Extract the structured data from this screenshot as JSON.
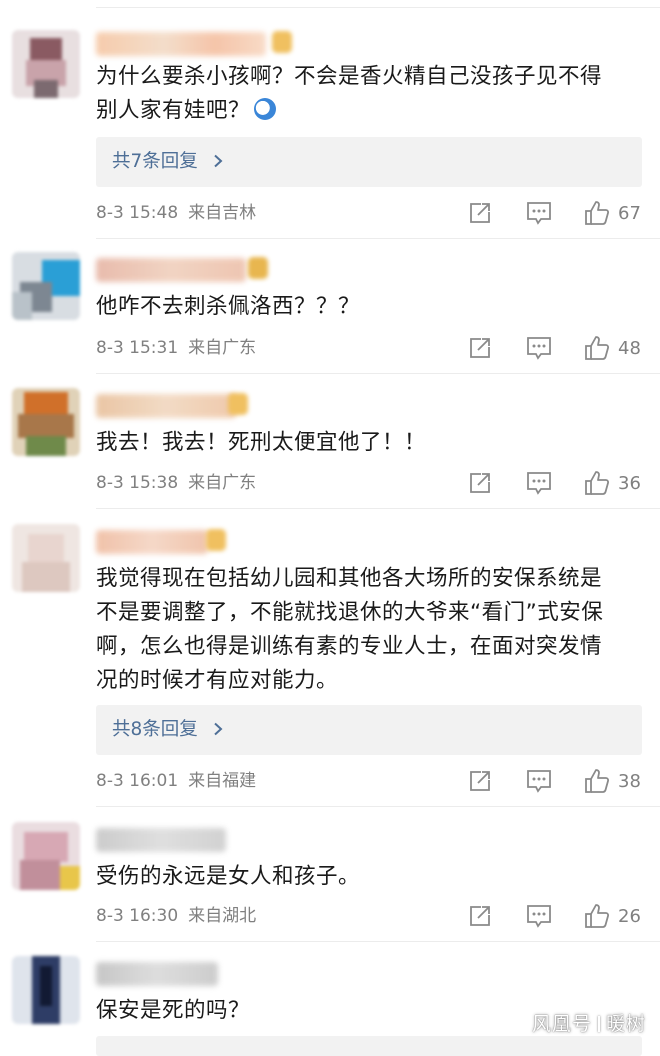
{
  "comments": [
    {
      "text_lines": [
        "为什么要杀小孩啊？不会是香火精自己没孩子见不得",
        "别人家有娃吧？"
      ],
      "has_emoji": true,
      "replies": "共7条回复",
      "time": "8-3 15:48",
      "location": "来自吉林",
      "likes": "67"
    },
    {
      "text_lines": [
        "他咋不去刺杀佩洛西？？？"
      ],
      "time": "8-3 15:31",
      "location": "来自广东",
      "likes": "48"
    },
    {
      "text_lines": [
        "我去！我去！死刑太便宜他了！！"
      ],
      "time": "8-3 15:38",
      "location": "来自广东",
      "likes": "36"
    },
    {
      "text_lines": [
        "我觉得现在包括幼儿园和其他各大场所的安保系统是",
        "不是要调整了，不能就找退休的大爷来“看门”式安保",
        "啊，怎么也得是训练有素的专业人士，在面对突发情",
        "况的时候才有应对能力。"
      ],
      "replies": "共8条回复",
      "time": "8-3 16:01",
      "location": "来自福建",
      "likes": "38"
    },
    {
      "text_lines": [
        "受伤的永远是女人和孩子。"
      ],
      "time": "8-3 16:30",
      "location": "来自湖北",
      "likes": "26"
    },
    {
      "text_lines": [
        "保安是死的吗？"
      ]
    }
  ],
  "icons": {
    "reply_chevron": "chevron-right-icon",
    "share": "share-icon",
    "comment": "comment-icon",
    "like": "thumbs-up-icon",
    "emoji": "emoji-icon"
  },
  "watermark": {
    "left": "风凰号",
    "right": "暖树"
  },
  "colors": {
    "link": "#4e6f97",
    "meta": "#808080",
    "reply_bg": "#f2f2f2"
  }
}
